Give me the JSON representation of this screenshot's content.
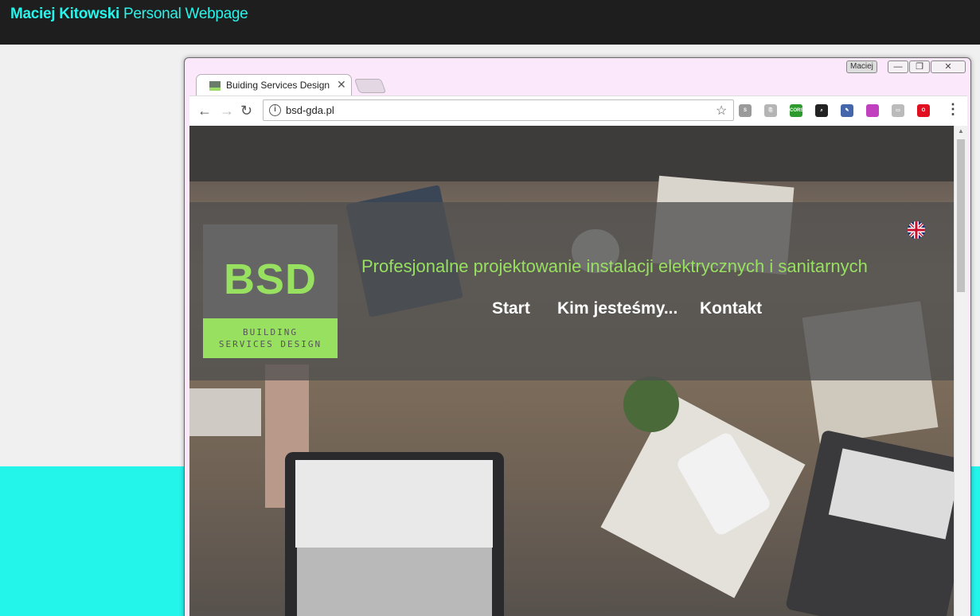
{
  "site": {
    "title_name": "Maciej Kitowski",
    "title_rest": " Personal Webpage"
  },
  "window": {
    "user": "Maciej",
    "min_symbol": "—",
    "max_symbol": "❐",
    "close_symbol": "✕"
  },
  "tab": {
    "favicon_text": "BSD",
    "title": "Buiding Services Design",
    "close_symbol": "✕"
  },
  "toolbar": {
    "back_symbol": "←",
    "forward_symbol": "→",
    "reload_symbol": "↻",
    "info_symbol": "i",
    "url": "bsd-gda.pl",
    "bookmark_symbol": "☆",
    "menu_symbol": "⋮",
    "extensions": [
      {
        "name": "skype-icon",
        "color": "#9a9a9a",
        "label": "S"
      },
      {
        "name": "pdf-icon",
        "color": "#b5b5b5",
        "label": "⎘"
      },
      {
        "name": "cors-icon",
        "color": "#2c9a2c",
        "label": "CORS"
      },
      {
        "name": "zoom-icon",
        "color": "#222222",
        "label": "⌕"
      },
      {
        "name": "eyedropper-icon",
        "color": "#4466aa",
        "label": "✎"
      },
      {
        "name": "gradient-icon",
        "color": "#c040c0",
        "label": ""
      },
      {
        "name": "cast-icon",
        "color": "#bbbbbb",
        "label": "▭"
      },
      {
        "name": "opera-icon",
        "color": "#e01020",
        "label": "O"
      }
    ]
  },
  "website": {
    "logo": "BSD",
    "logo_sub_line1": "BUILDING",
    "logo_sub_line2": "SERVICES DESIGN",
    "tagline": "Profesjonalne projektowanie instalacji elektrycznych i sanitarnych",
    "menu": [
      "Start",
      "Kim jesteśmy...",
      "Kontakt"
    ]
  },
  "colors": {
    "accent_cyan": "#24f5ea",
    "logo_green": "#98e060"
  }
}
